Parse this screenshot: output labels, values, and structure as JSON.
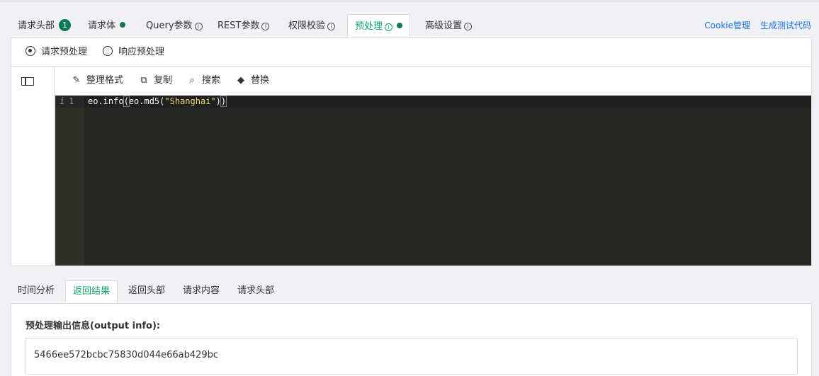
{
  "top_tabs": [
    {
      "label": "请求头部",
      "badge": "1"
    },
    {
      "label": "请求体"
    },
    {
      "label": "Query参数"
    },
    {
      "label": "REST参数"
    },
    {
      "label": "权限校验"
    },
    {
      "label": "预处理"
    },
    {
      "label": "高级设置"
    }
  ],
  "active_top_tab": "预处理",
  "info_glyph": "i",
  "links": {
    "cookie": "Cookie管理",
    "gen_code": "生成测试代码"
  },
  "pre_process": {
    "request_label": "请求预处理",
    "response_label": "响应预处理",
    "selected": "请求预处理"
  },
  "toolbar": {
    "format": "整理格式",
    "copy": "复制",
    "search": "搜索",
    "replace": "替换"
  },
  "editor": {
    "line_info": "i",
    "line_number": "1",
    "code_prefix": "eo.info",
    "code_paren_open": "(",
    "code_mid": "eo.md5(",
    "code_string": "\"Shanghai\"",
    "code_close_inner": ")",
    "code_paren_close": ")"
  },
  "bottom_tabs": [
    "时间分析",
    "返回结果",
    "返回头部",
    "请求内容",
    "请求头部"
  ],
  "active_bottom_tab": "返回结果",
  "output": {
    "label": "预处理输出信息(output info):",
    "value": "5466ee572bcbc75830d044e66ab429bc"
  },
  "colors": {
    "accent": "#10a36a",
    "badge": "#0d7a4f",
    "link": "#1a73e8",
    "editor_bg": "#272822",
    "string": "#e6db74"
  }
}
